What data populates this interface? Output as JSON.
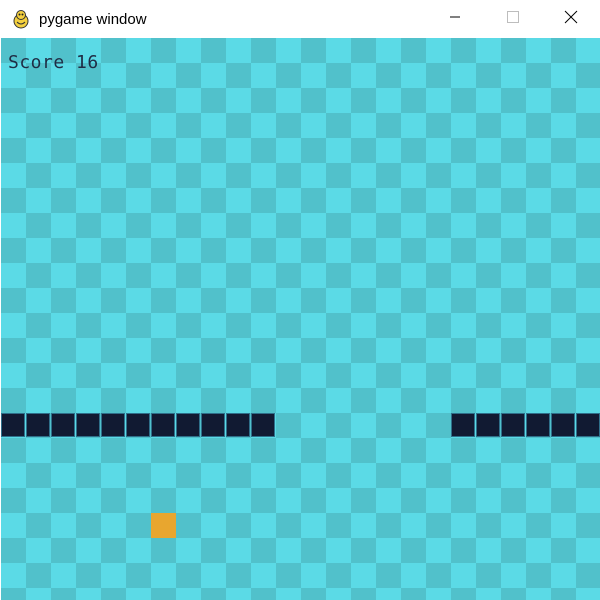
{
  "window": {
    "title": "pygame window",
    "app_icon": "pygame-snake-icon",
    "minimize_icon": "minimize-icon",
    "maximize_icon": "maximize-icon",
    "close_icon": "close-icon"
  },
  "game": {
    "score_text": "Score 16",
    "board_cols": 24,
    "board_rows": 23,
    "colors": {
      "tile_light": "#5bdae6",
      "tile_dark": "#51c1cb",
      "snake": "#111a32",
      "snake_outline": "#2f6f8a",
      "food": "#e8a62f",
      "score": "#1f2d45"
    },
    "snake_cells": [
      [
        0,
        15
      ],
      [
        1,
        15
      ],
      [
        2,
        15
      ],
      [
        3,
        15
      ],
      [
        4,
        15
      ],
      [
        5,
        15
      ],
      [
        6,
        15
      ],
      [
        7,
        15
      ],
      [
        8,
        15
      ],
      [
        9,
        15
      ],
      [
        10,
        15
      ],
      [
        18,
        15
      ],
      [
        19,
        15
      ],
      [
        20,
        15
      ],
      [
        21,
        15
      ],
      [
        22,
        15
      ],
      [
        23,
        15
      ]
    ],
    "food_cell": [
      6,
      19
    ]
  }
}
